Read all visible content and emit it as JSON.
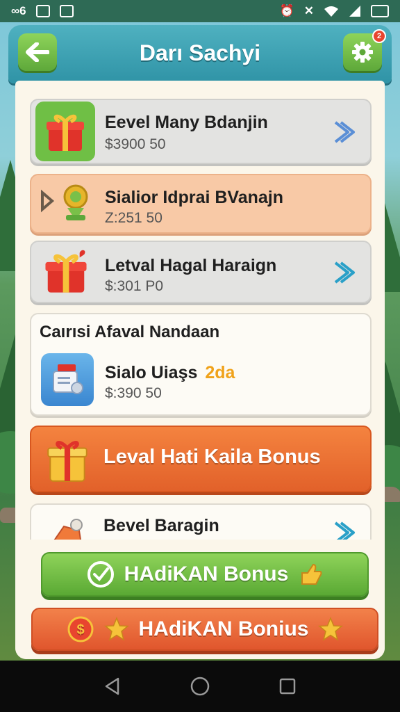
{
  "status_bar": {
    "left_icons": [
      "signal-dots-icon",
      "image-icon",
      "gallery-icon"
    ],
    "right_icons": [
      "alarm-icon",
      "vibrate-icon",
      "wifi-icon",
      "signal-icon",
      "battery-icon"
    ]
  },
  "header": {
    "title": "Darı Sachyi",
    "notification_count": "2"
  },
  "items": [
    {
      "title": "Eevel Many Bdanjin",
      "price": "$3900 50",
      "icon": "gift-box-icon",
      "style": "gray"
    },
    {
      "title": "Sialior Idprai BVanajn",
      "price": "Z:251 50",
      "icon": "trophy-medal-icon",
      "style": "peach"
    },
    {
      "title": "Letval Hagal Haraign",
      "price": "$:301 P0",
      "icon": "gift-box-icon",
      "style": "gray"
    }
  ],
  "section": {
    "heading": "Caırısi Afaval Nandaan",
    "item_title": "Sialo Uiaşs",
    "item_badge": "2da",
    "item_price": "$:390 50"
  },
  "bonus_banner": {
    "label": "Leval Hati Kaila Bonus"
  },
  "partial_item": {
    "title": "Bevel Baragin"
  },
  "buttons": {
    "green_label": "HAdiKAN Bonus",
    "orange_label": "HAdiKAN Bonius"
  },
  "colors": {
    "header": "#2f93a6",
    "green_button": "#5aa934",
    "orange_button": "#e0562d",
    "peach_item": "#f8c9a6",
    "panel_bg": "#fbf6ea"
  }
}
